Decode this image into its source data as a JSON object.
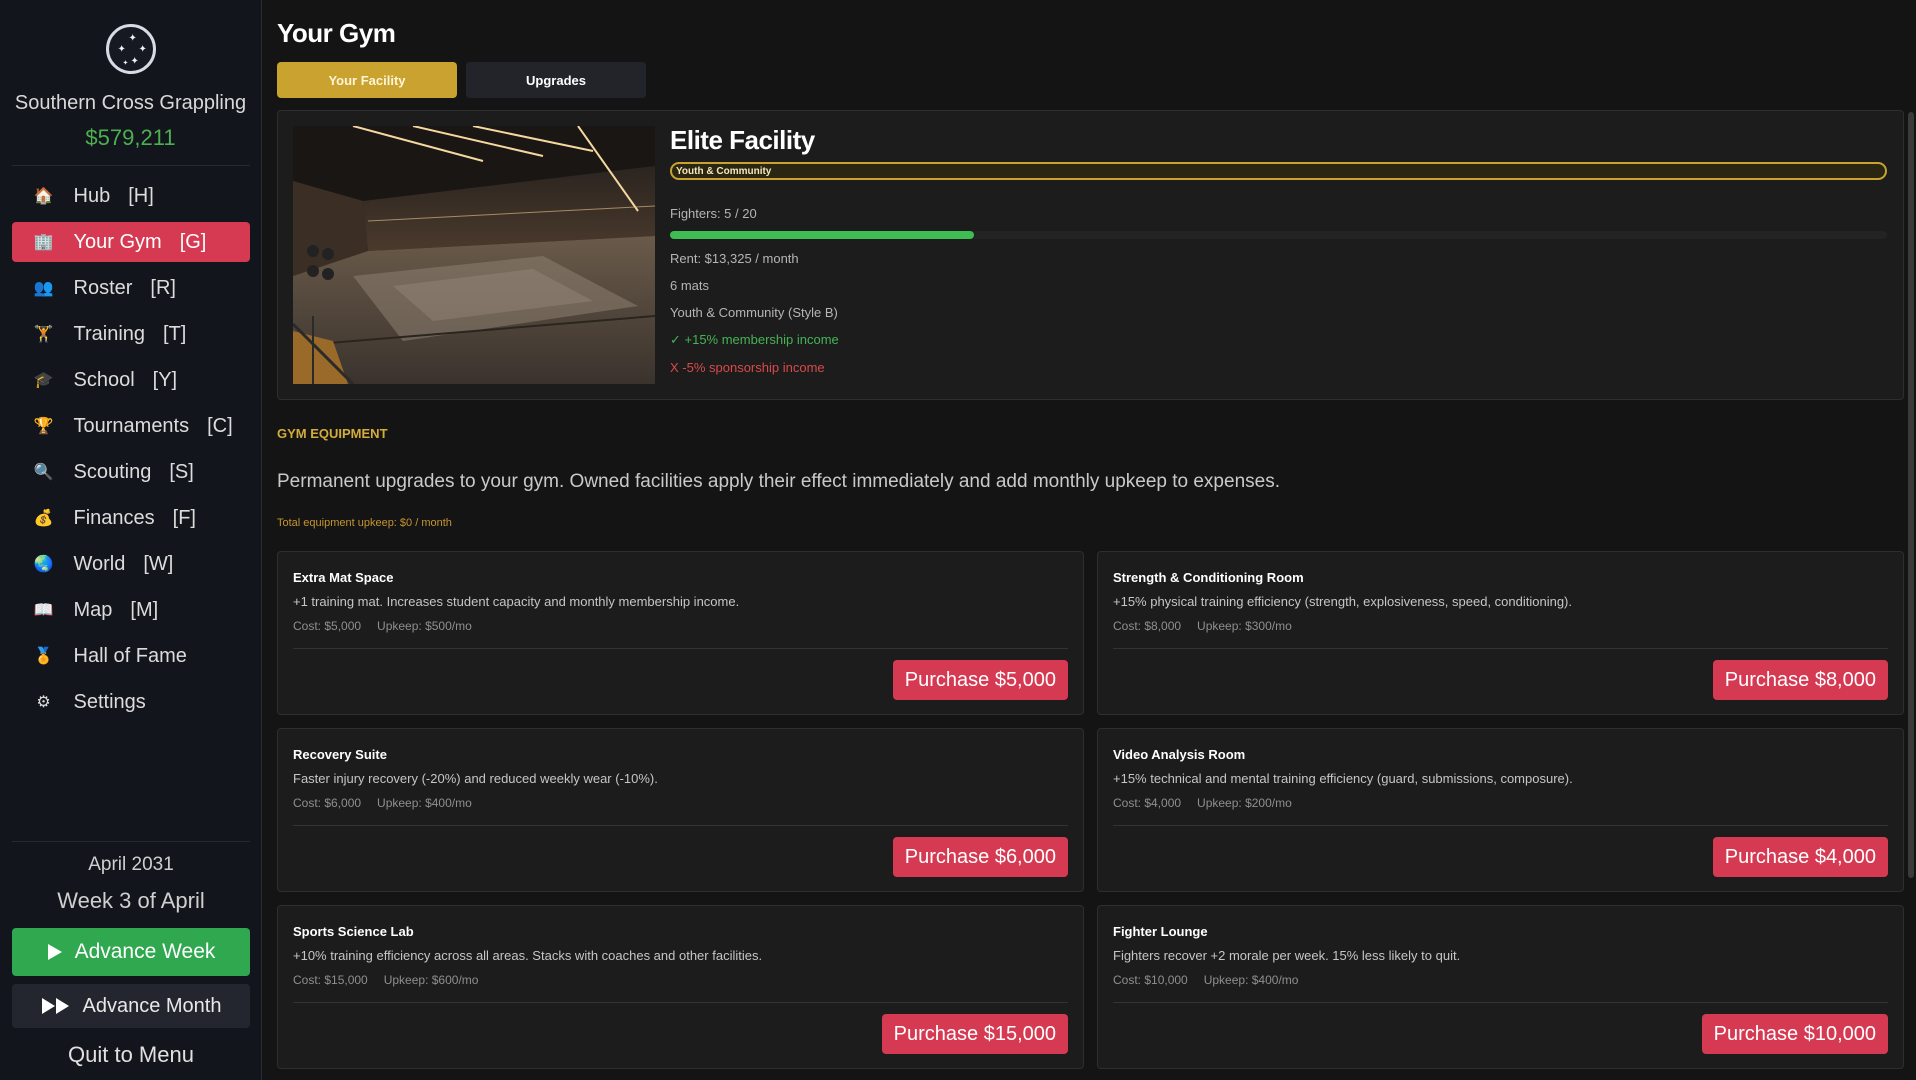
{
  "sidebar": {
    "gym_name": "Southern Cross Grappling",
    "money": "$579,211",
    "items": [
      {
        "label": "Hub",
        "key": "[H]",
        "icon": "home-icon",
        "glyph": "🏠"
      },
      {
        "label": "Your Gym",
        "key": "[G]",
        "icon": "building-icon",
        "glyph": "🏢"
      },
      {
        "label": "Roster",
        "key": "[R]",
        "icon": "people-icon",
        "glyph": "👥"
      },
      {
        "label": "Training",
        "key": "[T]",
        "icon": "dumbbell-icon",
        "glyph": "🏋"
      },
      {
        "label": "School",
        "key": "[Y]",
        "icon": "graduation-cap-icon",
        "glyph": "🎓"
      },
      {
        "label": "Tournaments",
        "key": "[C]",
        "icon": "trophy-icon",
        "glyph": "🏆"
      },
      {
        "label": "Scouting",
        "key": "[S]",
        "icon": "magnifier-icon",
        "glyph": "🔍"
      },
      {
        "label": "Finances",
        "key": "[F]",
        "icon": "money-bag-icon",
        "glyph": "💰"
      },
      {
        "label": "World",
        "key": "[W]",
        "icon": "globe-icon",
        "glyph": "🌏"
      },
      {
        "label": "Map",
        "key": "[M]",
        "icon": "map-icon",
        "glyph": "📖"
      },
      {
        "label": "Hall of Fame",
        "key": "",
        "icon": "medal-icon",
        "glyph": "🏅"
      },
      {
        "label": "Settings",
        "key": "",
        "icon": "gear-icon",
        "glyph": "⚙"
      }
    ],
    "active_index": 1,
    "date_month": "April 2031",
    "date_week": "Week 3 of April",
    "advance_week": "Advance Week",
    "advance_month": "Advance Month",
    "quit": "Quit to Menu"
  },
  "main": {
    "title": "Your Gym",
    "tabs": [
      {
        "label": "Your Facility",
        "active": true
      },
      {
        "label": "Upgrades",
        "active": false
      }
    ],
    "facility": {
      "title": "Elite Facility",
      "style_tag": "Youth & Community",
      "fighters": "Fighters: 5 / 20",
      "fighters_fraction": 0.25,
      "rent": "Rent: $13,325 / month",
      "mats": "6 mats",
      "style_line": "Youth & Community (Style B)",
      "bonus": "✓ +15% membership income",
      "penalty": "X -5% sponsorship income"
    },
    "equipment": {
      "section_title": "GYM EQUIPMENT",
      "description": "Permanent upgrades to your gym. Owned facilities apply their effect immediately and add monthly upkeep to expenses.",
      "total_upkeep": "Total equipment upkeep: $0 / month",
      "items": [
        {
          "name": "Extra Mat Space",
          "desc": "+1 training mat. Increases student capacity and monthly membership income.",
          "cost": "Cost: $5,000",
          "upkeep": "Upkeep: $500/mo",
          "button": "Purchase $5,000"
        },
        {
          "name": "Strength & Conditioning Room",
          "desc": "+15% physical training efficiency (strength, explosiveness, speed, conditioning).",
          "cost": "Cost: $8,000",
          "upkeep": "Upkeep: $300/mo",
          "button": "Purchase $8,000"
        },
        {
          "name": "Recovery Suite",
          "desc": "Faster injury recovery (-20%) and reduced weekly wear (-10%).",
          "cost": "Cost: $6,000",
          "upkeep": "Upkeep: $400/mo",
          "button": "Purchase $6,000"
        },
        {
          "name": "Video Analysis Room",
          "desc": "+15% technical and mental training efficiency (guard, submissions, composure).",
          "cost": "Cost: $4,000",
          "upkeep": "Upkeep: $200/mo",
          "button": "Purchase $4,000"
        },
        {
          "name": "Sports Science Lab",
          "desc": "+10% training efficiency across all areas. Stacks with coaches and other facilities.",
          "cost": "Cost: $15,000",
          "upkeep": "Upkeep: $600/mo",
          "button": "Purchase $15,000"
        },
        {
          "name": "Fighter Lounge",
          "desc": "Fighters recover +2 morale per week. 15% less likely to quit.",
          "cost": "Cost: $10,000",
          "upkeep": "Upkeep: $400/mo",
          "button": "Purchase $10,000"
        }
      ]
    }
  },
  "colors": {
    "accent_red": "#d63a52",
    "accent_gold": "#c9a230",
    "money_green": "#4caf50",
    "advance_green": "#2fa84f"
  }
}
